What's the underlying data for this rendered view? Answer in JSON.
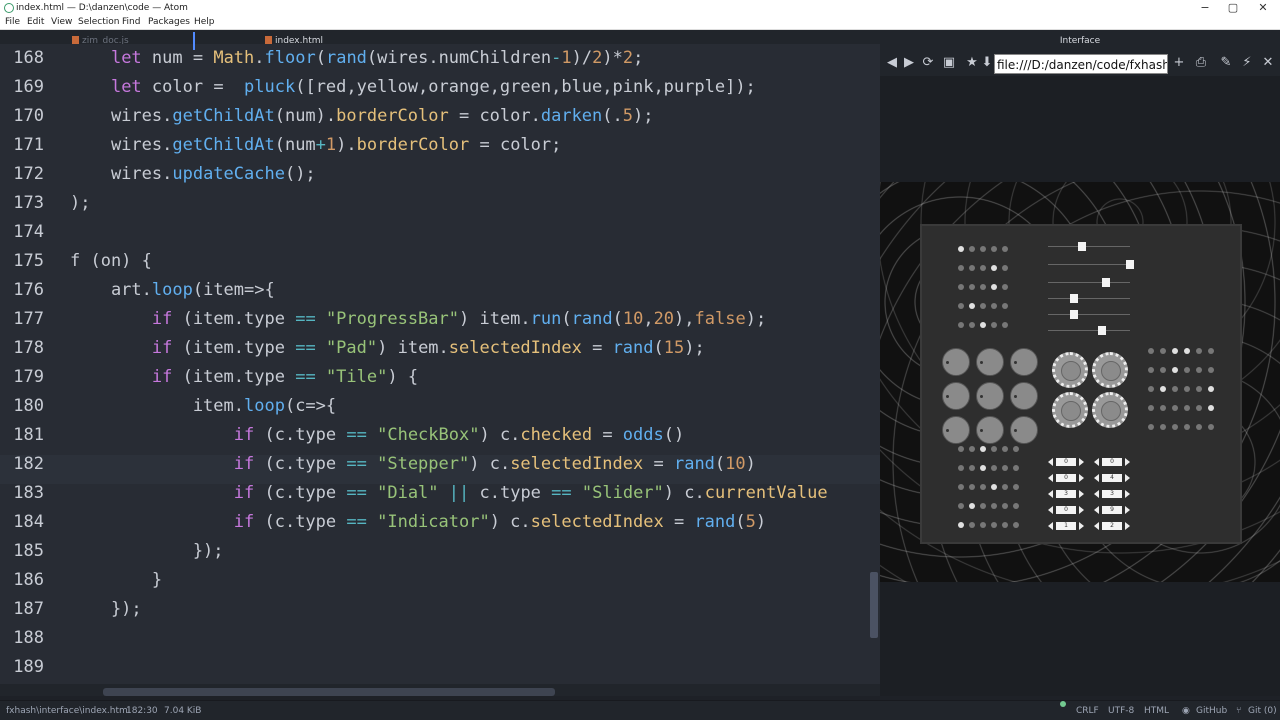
{
  "window": {
    "title": "index.html — D:\\danzen\\code — Atom",
    "minimize": "−",
    "maximize": "▢",
    "close": "✕"
  },
  "menu": [
    "File",
    "Edit",
    "View",
    "Selection",
    "Find",
    "Packages",
    "Help"
  ],
  "tabs": [
    {
      "label": "zim_doc.js",
      "active": false
    },
    {
      "label": "index.html",
      "active": true
    }
  ],
  "editor": {
    "line_numbers": [
      "168",
      "169",
      "170",
      "171",
      "172",
      "173",
      "174",
      "175",
      "176",
      "177",
      "178",
      "179",
      "180",
      "181",
      "182",
      "183",
      "184",
      "185",
      "186",
      "187",
      "188",
      "189"
    ],
    "current_line": "182"
  },
  "preview": {
    "tab_title": "Interface",
    "url": "file:///D:/danzen/code/fxhash",
    "stepper_values": [
      "0",
      "0",
      "3",
      "0",
      "1",
      "0",
      "4",
      "3",
      "9",
      "2"
    ]
  },
  "status": {
    "path": "fxhash\\interface\\index.html",
    "cursor": "182:30",
    "size": "7.04 KiB",
    "line_ending": "CRLF",
    "encoding": "UTF-8",
    "grammar": "HTML",
    "github": "GitHub",
    "git": "Git (0)"
  },
  "colors": {
    "keyword": "#c678dd",
    "function": "#61afef",
    "string": "#98c379",
    "number": "#d19a66",
    "class": "#e5c07b"
  }
}
